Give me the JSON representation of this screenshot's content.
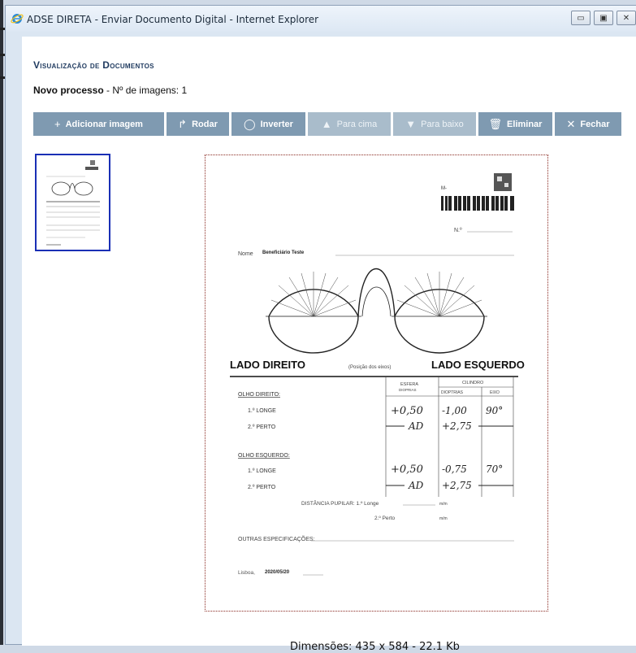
{
  "window": {
    "title": "ADSE DIRETA - Enviar Documento Digital - Internet Explorer",
    "buttons": [
      "minimize",
      "maximize",
      "close"
    ]
  },
  "header": {
    "heading": "Visualização de Documentos",
    "process_label": "Novo processo",
    "images_label": " - Nº de imagens: 1"
  },
  "toolbar": [
    {
      "id": "add",
      "icon": "plus-icon",
      "glyph": "+",
      "label": "Adicionar imagem",
      "enabled": true
    },
    {
      "id": "rotate",
      "icon": "rotate-icon",
      "glyph": "↱",
      "label": "Rodar",
      "enabled": true
    },
    {
      "id": "invert",
      "icon": "invert-icon",
      "glyph": "◯",
      "label": "Inverter",
      "enabled": true
    },
    {
      "id": "up",
      "icon": "arrow-up-icon",
      "glyph": "▲",
      "label": "Para cima",
      "enabled": false
    },
    {
      "id": "down",
      "icon": "arrow-down-icon",
      "glyph": "▼",
      "label": "Para baixo",
      "enabled": false
    },
    {
      "id": "delete",
      "icon": "trash-icon",
      "glyph": "🗑",
      "label": "Eliminar",
      "enabled": true
    },
    {
      "id": "close",
      "icon": "close-icon",
      "glyph": "✕",
      "label": "Fechar",
      "enabled": true
    }
  ],
  "document": {
    "m_label": "M-",
    "n_label": "N.º",
    "nome_label": "Nome",
    "nome_value": "Beneficiário Teste",
    "lado_direito": "LADO DIREITO",
    "posicao": "(Posição dos eixos)",
    "lado_esquerdo": "LADO ESQUERDO",
    "col_esfera": "ESFERA",
    "col_esfera_sub": "DIOPRIAS",
    "col_cilindro": "CILINDRO",
    "col_dioptrias": "DIOPTRIAS",
    "col_eixo": "EIXO",
    "olho_direito": "OLHO DIREITO:",
    "olho_esquerdo": "OLHO ESQUERDO:",
    "longe": "1.º LONGE",
    "perto": "2.º PERTO",
    "od_longe": [
      "+0,50",
      "-1,00",
      "90°"
    ],
    "od_perto": [
      "AD",
      "+2,75"
    ],
    "oe_longe": [
      "+0,50",
      "-0,75",
      "70°"
    ],
    "oe_perto": [
      "AD",
      "+2,75"
    ],
    "dist_pupilar": "DISTÂNCIA PUPILAR: 1.º Longe",
    "dist_perto": "2.º Perto",
    "mm": "m/m",
    "outras": "OUTRAS ESPECIFICAÇÕES:",
    "lisboa": "Lisboa,",
    "date": "2020/05/20"
  },
  "footer": {
    "dimensions": "Dimensões: 435 x 584  -  22.1 Kb"
  },
  "colors": {
    "button": "#7f9ab1",
    "button_disabled": "#a9bccb",
    "thumb_border": "#1a2fb5",
    "heading": "#1f3a5f"
  }
}
